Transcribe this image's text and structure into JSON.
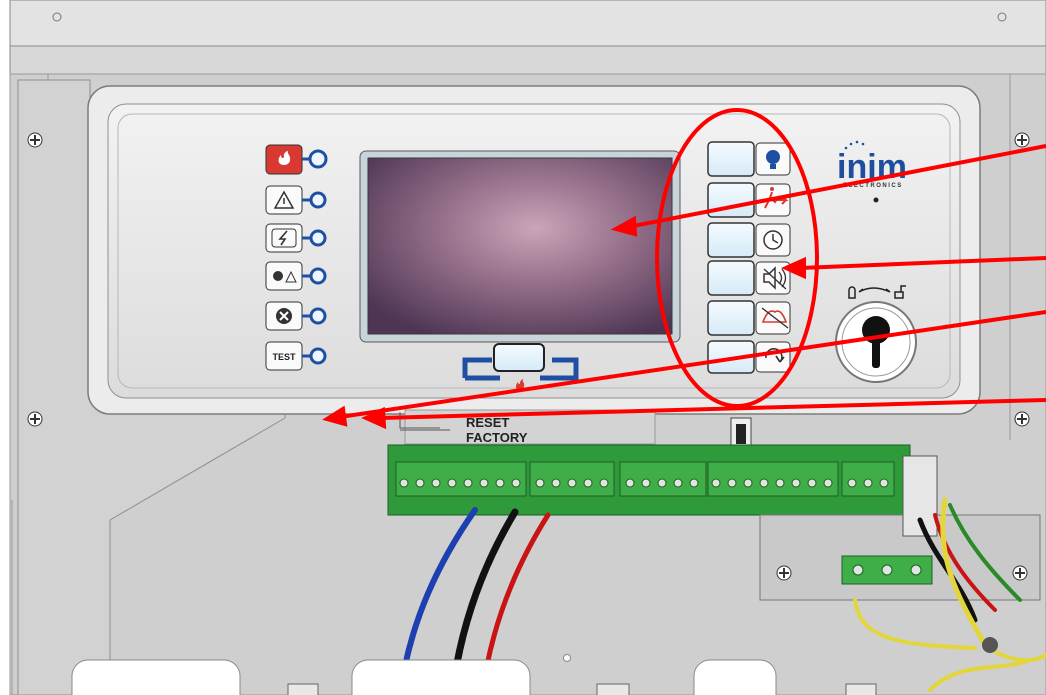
{
  "panel": {
    "brand_name": "inim",
    "brand_sub": "ELECTRONICS",
    "test_label": "TEST",
    "reset_label": "RESET",
    "factory_label": "FACTORY",
    "colors": {
      "enclosure": "#d9d9d9",
      "panel_face": "#e8e8e8",
      "screen": "#7a5a73",
      "led_ring": "#2e5fb0",
      "annotation": "#ff0000",
      "pcb": "#2f9a3a",
      "terminal": "#3fae48",
      "brand": "#1f4e9e"
    }
  },
  "indicators": [
    {
      "name": "fire-indicator-icon",
      "kind": "fire"
    },
    {
      "name": "fault-indicator-icon",
      "kind": "warning"
    },
    {
      "name": "power-fault-indicator-icon",
      "kind": "power"
    },
    {
      "name": "supervisory-indicator-icon",
      "kind": "supervisory"
    },
    {
      "name": "disabled-indicator-icon",
      "kind": "disabled"
    },
    {
      "name": "test-indicator-icon",
      "kind": "test"
    }
  ],
  "side_buttons": [
    {
      "name": "lamp-test-button",
      "icon": "bulb-icon"
    },
    {
      "name": "evacuate-button",
      "icon": "evacuate-icon"
    },
    {
      "name": "delay-button",
      "icon": "clock-icon"
    },
    {
      "name": "silence-buzzer-button",
      "icon": "buzzer-mute-icon"
    },
    {
      "name": "silence-sounder-button",
      "icon": "sounder-mute-icon"
    },
    {
      "name": "reset-button",
      "icon": "reset-icon"
    }
  ]
}
